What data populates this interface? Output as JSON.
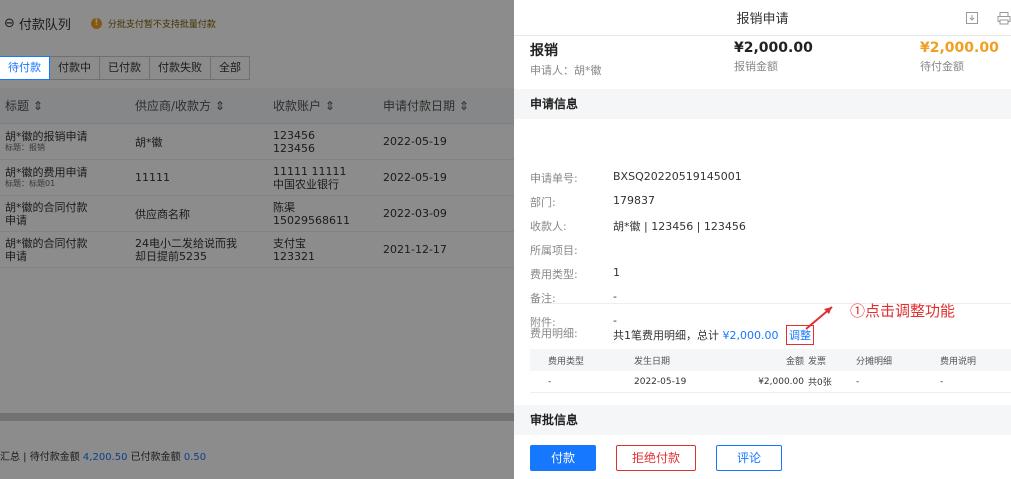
{
  "left": {
    "back_label": "付款队列",
    "warning": "分批支付暂不支持批量付款",
    "tabs": [
      "待付款",
      "付款中",
      "已付款",
      "付款失败",
      "全部"
    ],
    "columns": [
      "标题 ⇕",
      "供应商/收款方 ⇕",
      "收款账户 ⇕",
      "申请付款日期 ⇕"
    ],
    "rows": [
      {
        "title": "胡*徽的报销申请",
        "sub": "标题：报销",
        "vendor": "胡*徽",
        "acct1": "123456",
        "acct2": "123456",
        "date": "2022-05-19"
      },
      {
        "title": "胡*徽的费用申请",
        "sub": "标题：标题01",
        "vendor": "11111",
        "acct1": "11111 11111",
        "acct2": "中国农业银行",
        "date": "2022-05-19"
      },
      {
        "title": "胡*徽的合同付款",
        "sub": "申请",
        "vendor": "供应商名称",
        "acct1": "陈渠",
        "acct2": "15029568611",
        "date": "2022-03-09"
      },
      {
        "title": "胡*徽的合同付款",
        "sub": "申请",
        "vendor": "24电小二发给说而我",
        "vendor2": "却日提前5235",
        "acct1": "支付宝",
        "acct2": "123321",
        "date": "2021-12-17"
      }
    ],
    "footer": {
      "prefix": "汇总 | 待付款金额",
      "pending": "4,200.50",
      "paid_label": "已付款金额",
      "paid": "0.50"
    }
  },
  "right": {
    "title": "报销申请",
    "summary": {
      "type": "报销",
      "applicant": "申请人：胡*徽",
      "amount": "¥2,000.00",
      "amount_label": "报销金额",
      "pending": "¥2,000.00",
      "pending_label": "待付金额"
    },
    "section_apply": "申请信息",
    "fields": [
      {
        "label": "申请单号:",
        "value": "BXSQ20220519145001"
      },
      {
        "label": "部门:",
        "value": "179837"
      },
      {
        "label": "收款人:",
        "value": "胡*徽 | 123456 | 123456"
      },
      {
        "label": "所属项目:",
        "value": ""
      },
      {
        "label": "费用类型:",
        "value": "1"
      },
      {
        "label": "备注:",
        "value": "-"
      },
      {
        "label": "附件:",
        "value": "-"
      }
    ],
    "detail": {
      "label": "费用明细:",
      "text": "共1笔费用明细，总计",
      "amount": "¥2,000.00",
      "adjust": "调整"
    },
    "annotation": "①点击调整功能",
    "detail_table": {
      "columns": [
        "费用类型",
        "发生日期",
        "金额",
        "发票",
        "分摊明细",
        "费用说明"
      ],
      "row": [
        "-",
        "2022-05-19",
        "¥2,000.00",
        "共0张",
        "-",
        "-"
      ]
    },
    "section_approval": "审批信息",
    "buttons": {
      "pay": "付款",
      "reject": "拒绝付款",
      "comment": "评论"
    }
  },
  "colors": {
    "accent": "#1677ff",
    "danger": "#e03030",
    "warning": "#f0a020"
  }
}
